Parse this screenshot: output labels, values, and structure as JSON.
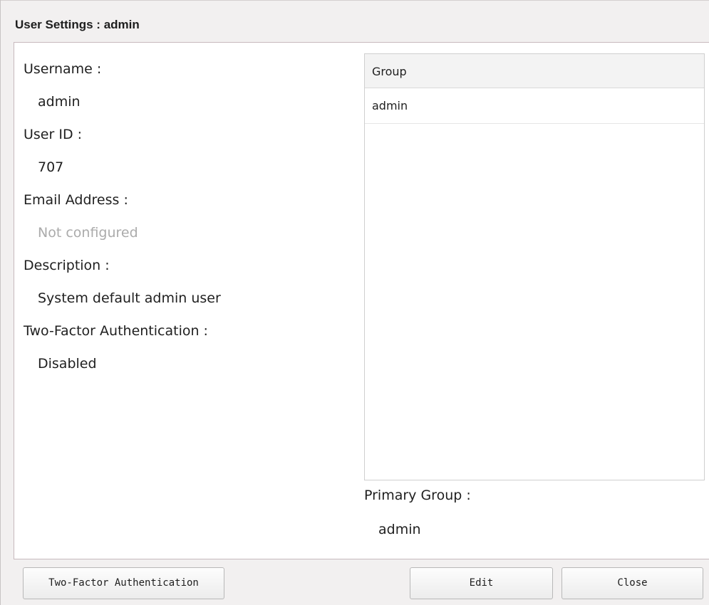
{
  "dialog": {
    "title": "User Settings : admin"
  },
  "details": {
    "username_label": "Username :",
    "username_value": "admin",
    "user_id_label": "User ID :",
    "user_id_value": "707",
    "email_label": "Email Address :",
    "email_value": "Not configured",
    "description_label": "Description :",
    "description_value": "System default admin user",
    "two_factor_label": "Two-Factor Authentication :",
    "two_factor_value": "Disabled"
  },
  "groups": {
    "column_header": "Group",
    "rows": [
      "admin"
    ]
  },
  "primary_group": {
    "label": "Primary Group :",
    "value": "admin"
  },
  "buttons": {
    "two_factor": "Two-Factor Authentication",
    "edit": "Edit",
    "close": "Close"
  },
  "colors": {
    "muted_text": "#ababab",
    "panel_border": "#c7b9bd",
    "dialog_background": "#f2f0f0"
  }
}
